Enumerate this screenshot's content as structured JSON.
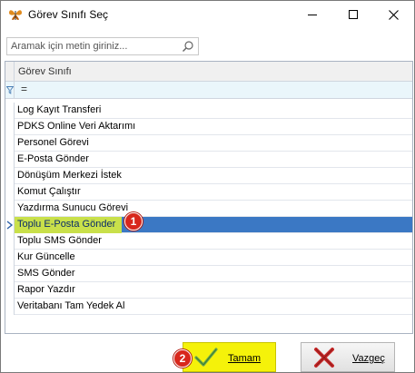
{
  "window": {
    "title": "Görev Sınıfı Seç",
    "controls": [
      "minimize-icon",
      "maximize-icon",
      "close-icon"
    ]
  },
  "search": {
    "placeholder": "Aramak için metin giriniz...",
    "value": ""
  },
  "grid": {
    "column_header": "Görev Sınıfı",
    "filter_operator": "=",
    "rows": [
      "Log Kayıt Transferi",
      "PDKS Online Veri Aktarımı",
      "Personel Görevi",
      "E-Posta Gönder",
      "Dönüşüm Merkezi İstek",
      "Komut Çalıştır",
      "Yazdırma Sunucu Görevi",
      "Toplu E-Posta Gönder",
      "Toplu SMS Gönder",
      "Kur Güncelle",
      "SMS Gönder",
      "Rapor Yazdır",
      "Veritabanı Tam Yedek Al"
    ],
    "selected_index": 7
  },
  "annotations": {
    "badge_1": "1",
    "badge_2": "2"
  },
  "buttons": {
    "ok_label": "Tamam",
    "cancel_label": "Vazgeç"
  },
  "colors": {
    "selection": "#3b78c4",
    "highlight": "#c9e04a",
    "ok_button": "#f5f20a",
    "badge": "#d8271c",
    "filter_row": "#eaf6fb"
  }
}
